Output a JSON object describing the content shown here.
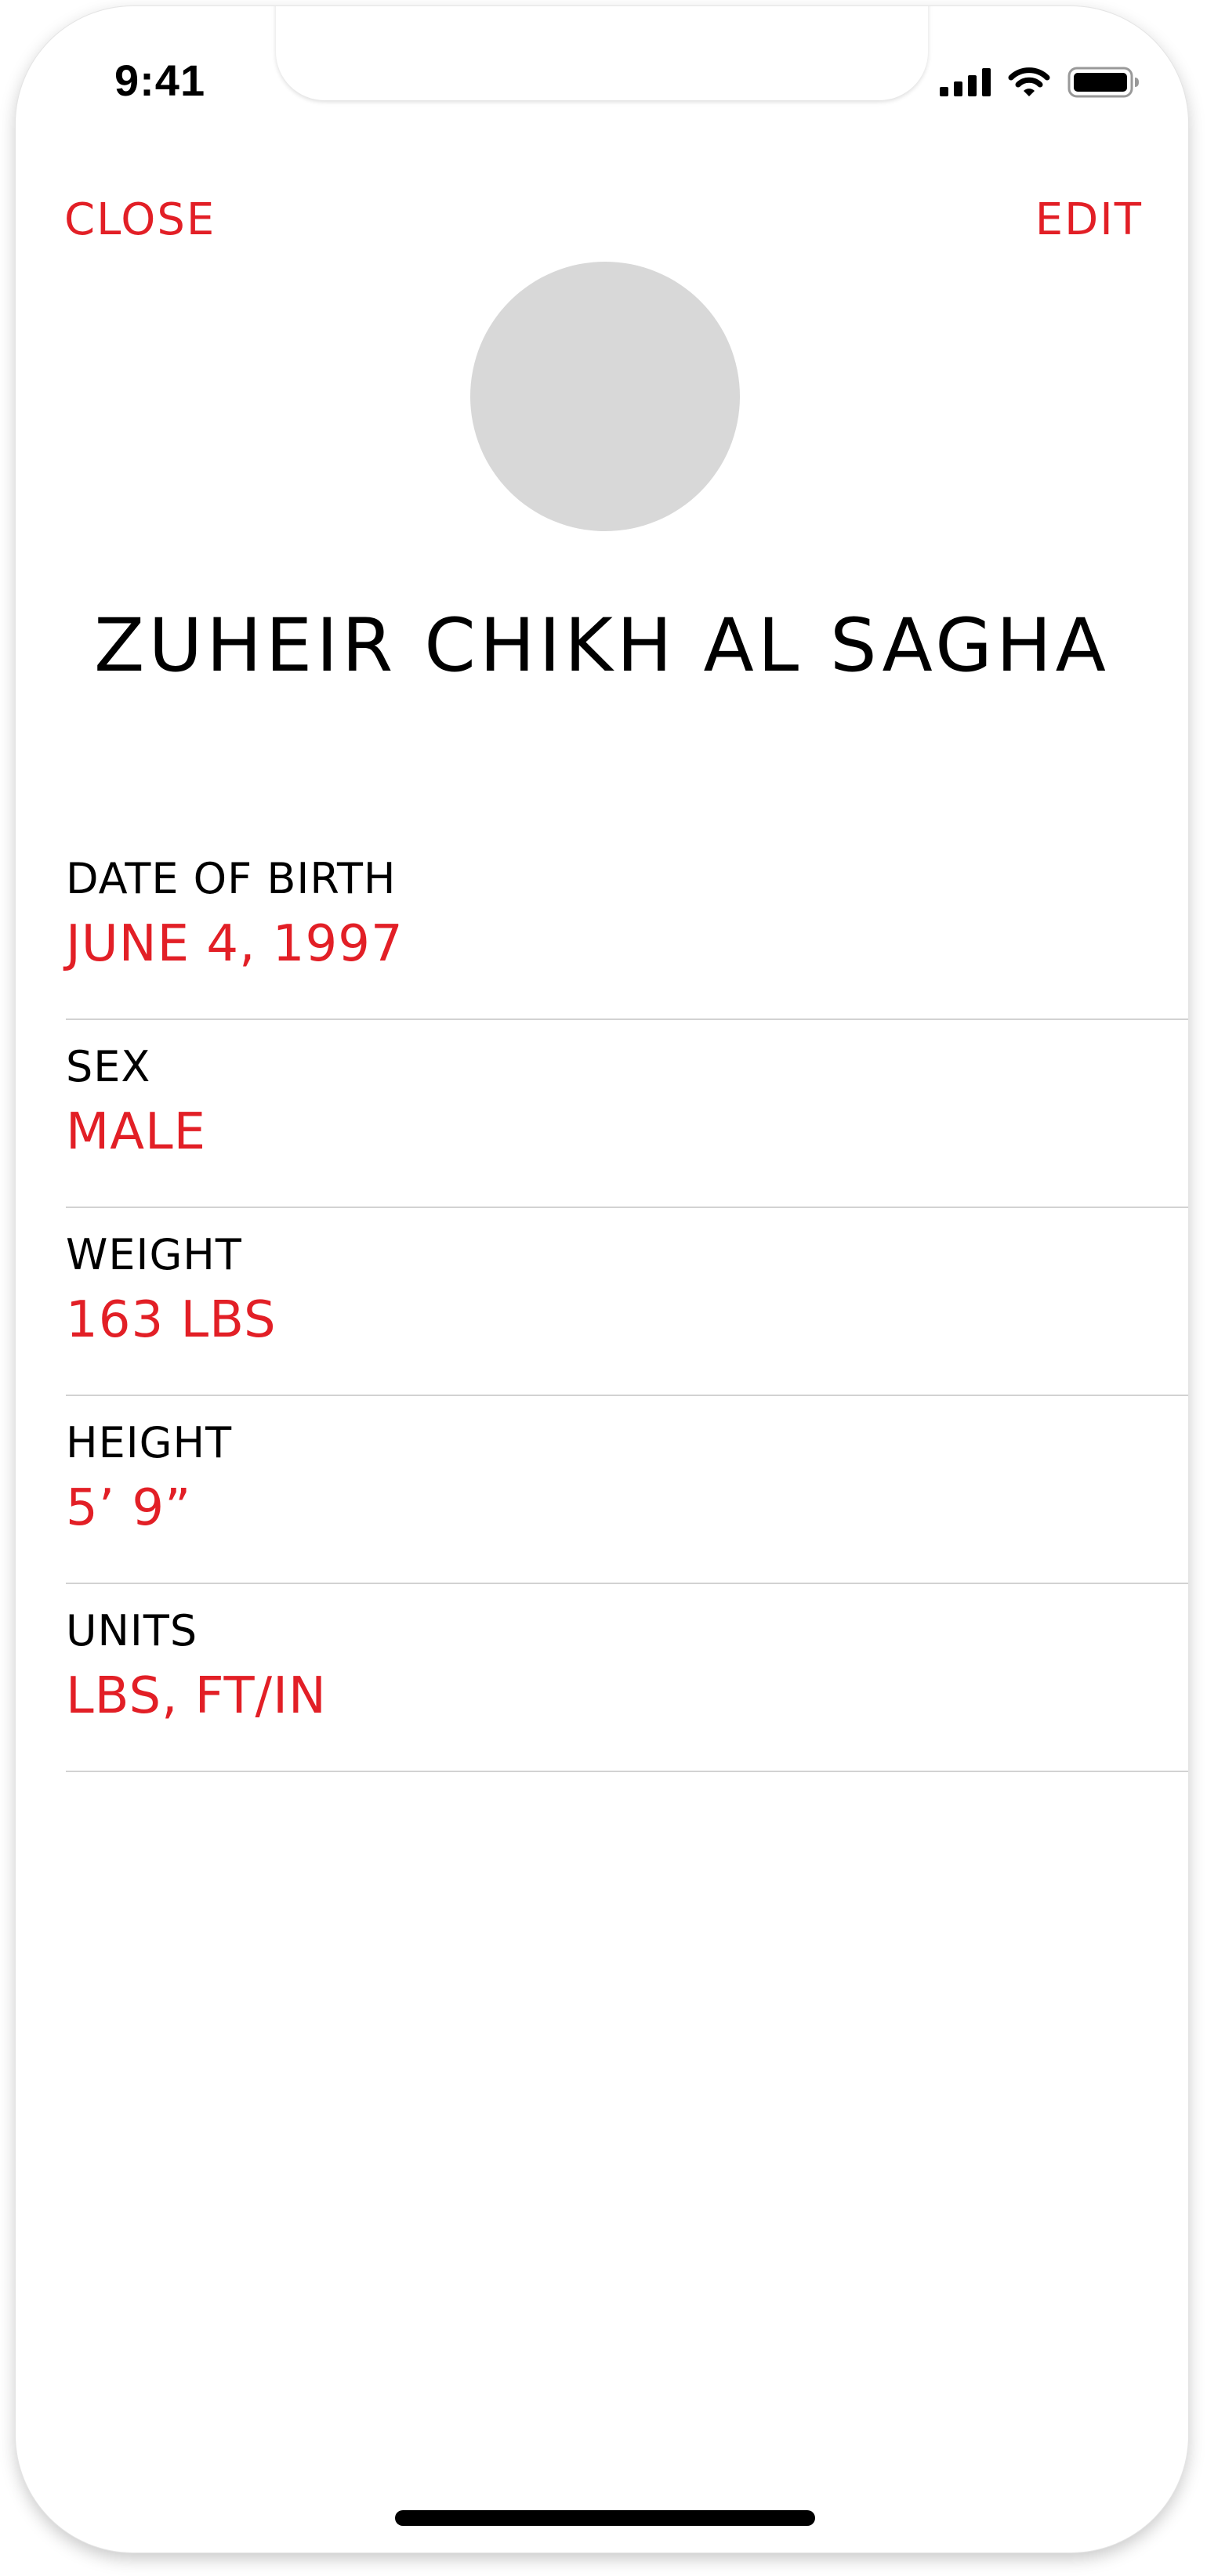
{
  "status_bar": {
    "time": "9:41",
    "icons": [
      "cellular-signal-icon",
      "wifi-icon",
      "battery-icon"
    ]
  },
  "navigation": {
    "close_label": "CLOSE",
    "edit_label": "EDIT"
  },
  "profile": {
    "avatar": "avatar-placeholder",
    "name": "ZUHEIR CHIKH AL SAGHA"
  },
  "fields": [
    {
      "label": "DATE OF BIRTH",
      "value": "JUNE 4, 1997"
    },
    {
      "label": "SEX",
      "value": "MALE"
    },
    {
      "label": "WEIGHT",
      "value": "163 LBS"
    },
    {
      "label": "HEIGHT",
      "value": "5’ 9”"
    },
    {
      "label": "UNITS",
      "value": "LBS, FT/IN"
    }
  ],
  "colors": {
    "accent": "#e21f26",
    "label": "#000000",
    "divider": "#d2d2d2",
    "avatar": "#d8d8d8"
  }
}
